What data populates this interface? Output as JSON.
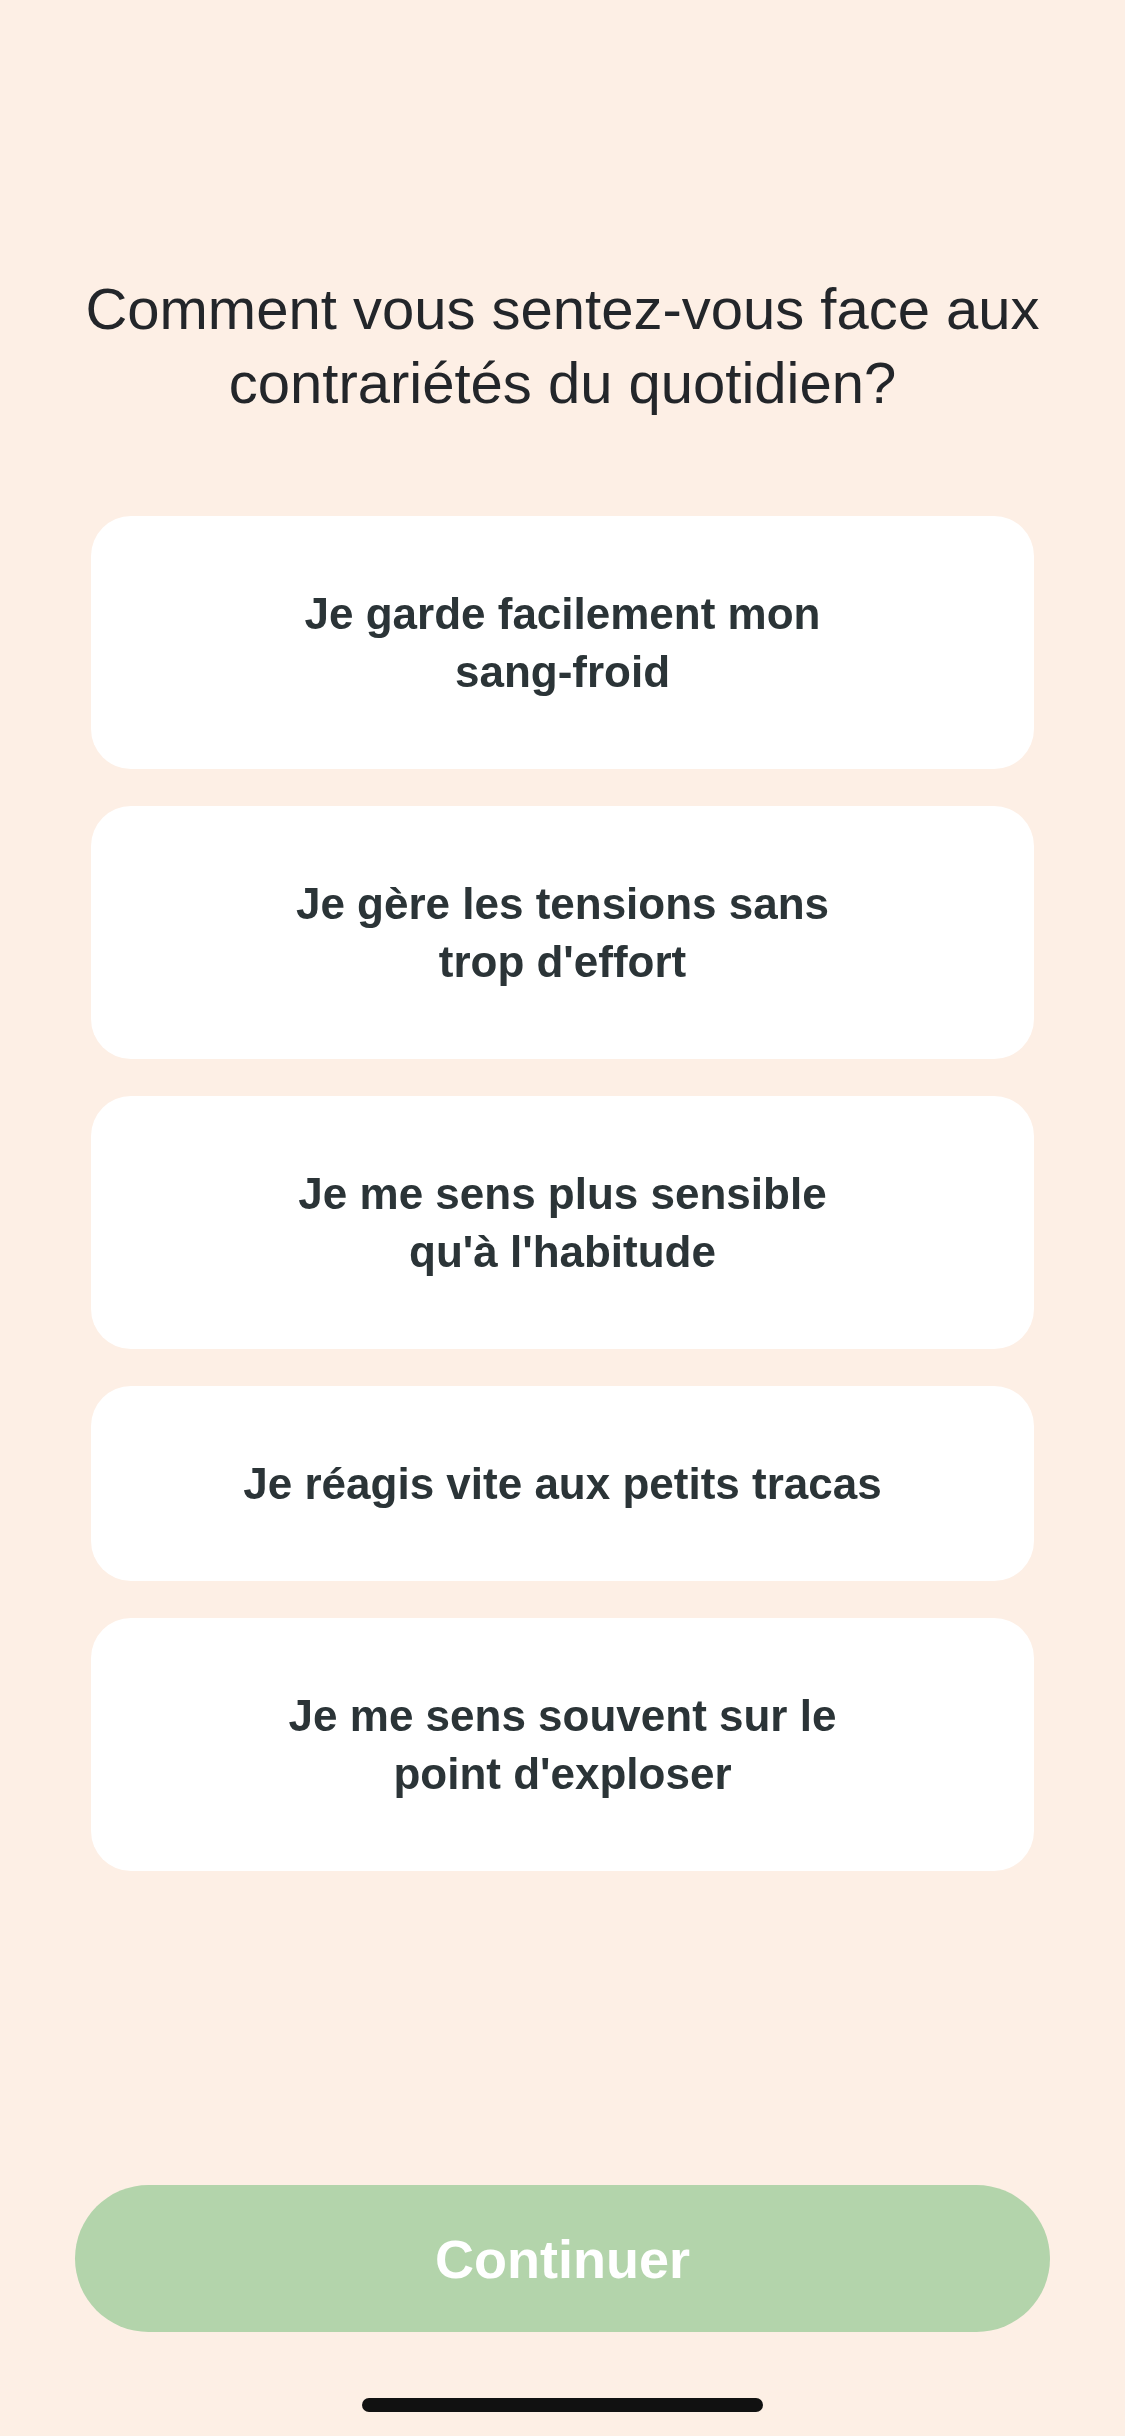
{
  "question": "Comment vous sentez-vous face aux contrariétés du quotidien?",
  "options": [
    {
      "label": "Je garde facilement mon\nsang-froid",
      "selected": false
    },
    {
      "label": "Je gère les tensions sans\ntrop d'effort",
      "selected": false
    },
    {
      "label": "Je me sens plus sensible\nqu'à l'habitude",
      "selected": false
    },
    {
      "label": "Je réagis vite aux petits tracas",
      "selected": false
    },
    {
      "label": "Je me sens souvent sur le\npoint d'exploser",
      "selected": false
    }
  ],
  "continue_button": {
    "label": "Continuer",
    "disabled": true
  }
}
